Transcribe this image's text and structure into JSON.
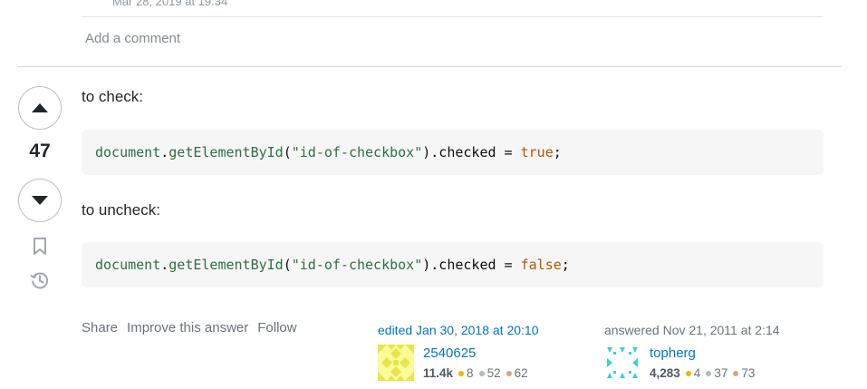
{
  "previous_comment": {
    "timestamp": "Mar 28, 2019 at 19:34"
  },
  "add_comment_label": "Add a comment",
  "vote": {
    "count": "47"
  },
  "answer": {
    "para_check": "to check:",
    "para_uncheck": "to uncheck:",
    "code_check": {
      "obj": "document",
      "dot": ".",
      "method": "getElementById",
      "open": "(",
      "arg": "\"id-of-checkbox\"",
      "rest": ").checked = ",
      "value": "true",
      "end": ";"
    },
    "code_uncheck": {
      "obj": "document",
      "dot": ".",
      "method": "getElementById",
      "open": "(",
      "arg": "\"id-of-checkbox\"",
      "rest": ").checked = ",
      "value": "false",
      "end": ";"
    }
  },
  "actions": {
    "share": "Share",
    "improve": "Improve this answer",
    "follow": "Follow"
  },
  "editor": {
    "label": "edited Jan 30, 2018 at 20:10",
    "name": "2540625",
    "reputation": "11.4k",
    "gold": "8",
    "silver": "52",
    "bronze": "62"
  },
  "author": {
    "label": "answered Nov 21, 2011 at 2:14",
    "name": "topherg",
    "reputation": "4,283",
    "gold": "4",
    "silver": "37",
    "bronze": "73"
  },
  "colors": {
    "link": "#0074cc",
    "gold": "#f1b600",
    "silver": "#b4b8bc",
    "bronze": "#d1a684",
    "code_bg": "#f6f6f6"
  }
}
